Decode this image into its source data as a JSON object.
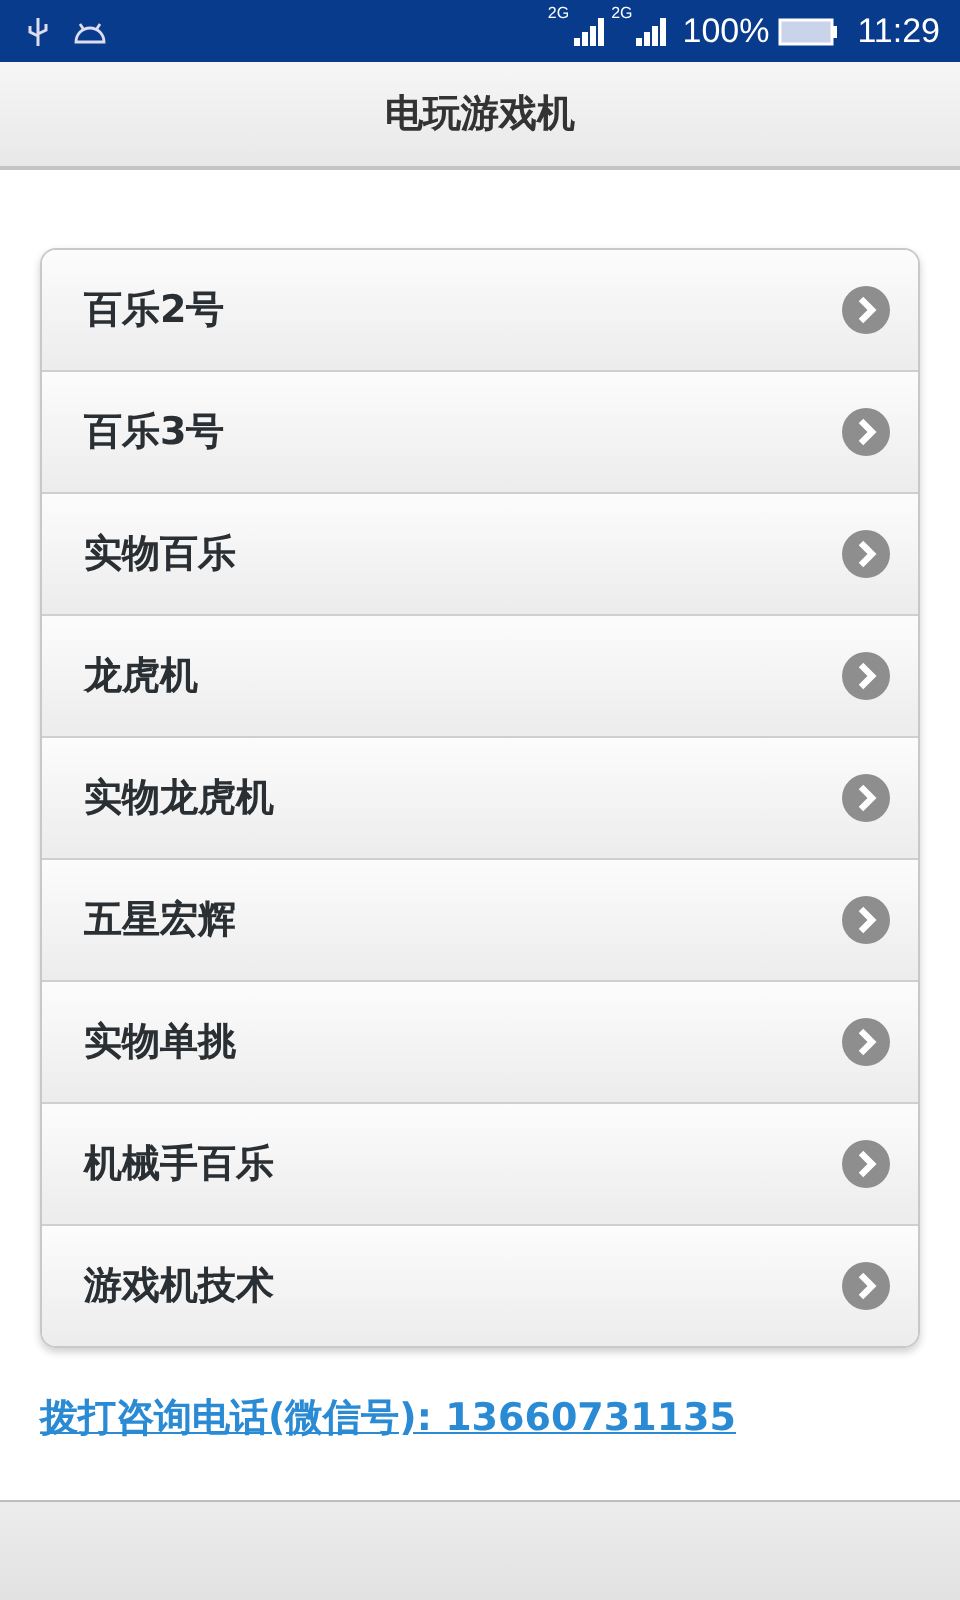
{
  "status_bar": {
    "signals": [
      {
        "label": "2G"
      },
      {
        "label": "2G"
      }
    ],
    "battery": "100%",
    "time": "11:29"
  },
  "header": {
    "title": "电玩游戏机"
  },
  "menu": {
    "items": [
      {
        "label": "百乐2号"
      },
      {
        "label": "百乐3号"
      },
      {
        "label": "实物百乐"
      },
      {
        "label": "龙虎机"
      },
      {
        "label": "实物龙虎机"
      },
      {
        "label": "五星宏辉"
      },
      {
        "label": "实物单挑"
      },
      {
        "label": "机械手百乐"
      },
      {
        "label": "游戏机技术"
      }
    ]
  },
  "contact_link": "拨打咨询电话(微信号): 13660731135"
}
